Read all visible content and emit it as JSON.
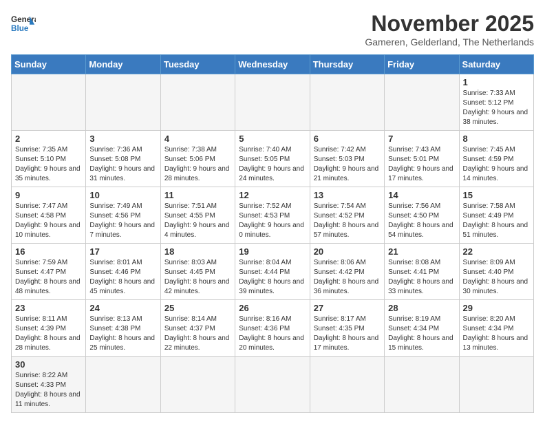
{
  "header": {
    "logo_general": "General",
    "logo_blue": "Blue",
    "month_title": "November 2025",
    "location": "Gameren, Gelderland, The Netherlands"
  },
  "weekdays": [
    "Sunday",
    "Monday",
    "Tuesday",
    "Wednesday",
    "Thursday",
    "Friday",
    "Saturday"
  ],
  "days": [
    {
      "date": null,
      "info": null
    },
    {
      "date": null,
      "info": null
    },
    {
      "date": null,
      "info": null
    },
    {
      "date": null,
      "info": null
    },
    {
      "date": null,
      "info": null
    },
    {
      "date": null,
      "info": null
    },
    {
      "date": "1",
      "info": "Sunrise: 7:33 AM\nSunset: 5:12 PM\nDaylight: 9 hours and 38 minutes."
    },
    {
      "date": "2",
      "info": "Sunrise: 7:35 AM\nSunset: 5:10 PM\nDaylight: 9 hours and 35 minutes."
    },
    {
      "date": "3",
      "info": "Sunrise: 7:36 AM\nSunset: 5:08 PM\nDaylight: 9 hours and 31 minutes."
    },
    {
      "date": "4",
      "info": "Sunrise: 7:38 AM\nSunset: 5:06 PM\nDaylight: 9 hours and 28 minutes."
    },
    {
      "date": "5",
      "info": "Sunrise: 7:40 AM\nSunset: 5:05 PM\nDaylight: 9 hours and 24 minutes."
    },
    {
      "date": "6",
      "info": "Sunrise: 7:42 AM\nSunset: 5:03 PM\nDaylight: 9 hours and 21 minutes."
    },
    {
      "date": "7",
      "info": "Sunrise: 7:43 AM\nSunset: 5:01 PM\nDaylight: 9 hours and 17 minutes."
    },
    {
      "date": "8",
      "info": "Sunrise: 7:45 AM\nSunset: 4:59 PM\nDaylight: 9 hours and 14 minutes."
    },
    {
      "date": "9",
      "info": "Sunrise: 7:47 AM\nSunset: 4:58 PM\nDaylight: 9 hours and 10 minutes."
    },
    {
      "date": "10",
      "info": "Sunrise: 7:49 AM\nSunset: 4:56 PM\nDaylight: 9 hours and 7 minutes."
    },
    {
      "date": "11",
      "info": "Sunrise: 7:51 AM\nSunset: 4:55 PM\nDaylight: 9 hours and 4 minutes."
    },
    {
      "date": "12",
      "info": "Sunrise: 7:52 AM\nSunset: 4:53 PM\nDaylight: 9 hours and 0 minutes."
    },
    {
      "date": "13",
      "info": "Sunrise: 7:54 AM\nSunset: 4:52 PM\nDaylight: 8 hours and 57 minutes."
    },
    {
      "date": "14",
      "info": "Sunrise: 7:56 AM\nSunset: 4:50 PM\nDaylight: 8 hours and 54 minutes."
    },
    {
      "date": "15",
      "info": "Sunrise: 7:58 AM\nSunset: 4:49 PM\nDaylight: 8 hours and 51 minutes."
    },
    {
      "date": "16",
      "info": "Sunrise: 7:59 AM\nSunset: 4:47 PM\nDaylight: 8 hours and 48 minutes."
    },
    {
      "date": "17",
      "info": "Sunrise: 8:01 AM\nSunset: 4:46 PM\nDaylight: 8 hours and 45 minutes."
    },
    {
      "date": "18",
      "info": "Sunrise: 8:03 AM\nSunset: 4:45 PM\nDaylight: 8 hours and 42 minutes."
    },
    {
      "date": "19",
      "info": "Sunrise: 8:04 AM\nSunset: 4:44 PM\nDaylight: 8 hours and 39 minutes."
    },
    {
      "date": "20",
      "info": "Sunrise: 8:06 AM\nSunset: 4:42 PM\nDaylight: 8 hours and 36 minutes."
    },
    {
      "date": "21",
      "info": "Sunrise: 8:08 AM\nSunset: 4:41 PM\nDaylight: 8 hours and 33 minutes."
    },
    {
      "date": "22",
      "info": "Sunrise: 8:09 AM\nSunset: 4:40 PM\nDaylight: 8 hours and 30 minutes."
    },
    {
      "date": "23",
      "info": "Sunrise: 8:11 AM\nSunset: 4:39 PM\nDaylight: 8 hours and 28 minutes."
    },
    {
      "date": "24",
      "info": "Sunrise: 8:13 AM\nSunset: 4:38 PM\nDaylight: 8 hours and 25 minutes."
    },
    {
      "date": "25",
      "info": "Sunrise: 8:14 AM\nSunset: 4:37 PM\nDaylight: 8 hours and 22 minutes."
    },
    {
      "date": "26",
      "info": "Sunrise: 8:16 AM\nSunset: 4:36 PM\nDaylight: 8 hours and 20 minutes."
    },
    {
      "date": "27",
      "info": "Sunrise: 8:17 AM\nSunset: 4:35 PM\nDaylight: 8 hours and 17 minutes."
    },
    {
      "date": "28",
      "info": "Sunrise: 8:19 AM\nSunset: 4:34 PM\nDaylight: 8 hours and 15 minutes."
    },
    {
      "date": "29",
      "info": "Sunrise: 8:20 AM\nSunset: 4:34 PM\nDaylight: 8 hours and 13 minutes."
    },
    {
      "date": "30",
      "info": "Sunrise: 8:22 AM\nSunset: 4:33 PM\nDaylight: 8 hours and 11 minutes."
    }
  ]
}
